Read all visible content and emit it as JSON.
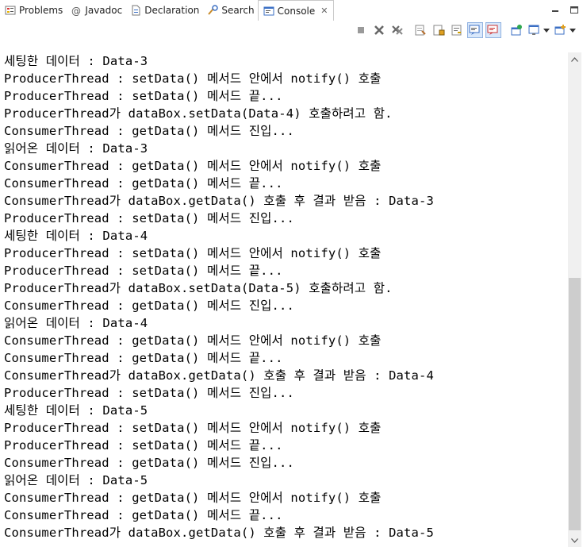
{
  "tabs": [
    {
      "label": "Problems",
      "icon": "problems-icon"
    },
    {
      "label": "Javadoc",
      "icon": "javadoc-icon"
    },
    {
      "label": "Declaration",
      "icon": "declaration-icon"
    },
    {
      "label": "Search",
      "icon": "search-icon"
    },
    {
      "label": "Console",
      "icon": "console-icon",
      "active": true
    }
  ],
  "console": {
    "lines": [
      "세팅한 데이터 : Data-3",
      "ProducerThread : setData() 메서드 안에서 notify() 호출",
      "ProducerThread : setData() 메서드 끝...",
      "ProducerThread가 dataBox.setData(Data-4) 호출하려고 함.",
      "ConsumerThread : getData() 메서드 진입...",
      "읽어온 데이터 : Data-3",
      "ConsumerThread : getData() 메서드 안에서 notify() 호출",
      "ConsumerThread : getData() 메서드 끝...",
      "ConsumerThread가 dataBox.getData() 호출 후 결과 받음 : Data-3",
      "ProducerThread : setData() 메서드 진입...",
      "세팅한 데이터 : Data-4",
      "ProducerThread : setData() 메서드 안에서 notify() 호출",
      "ProducerThread : setData() 메서드 끝...",
      "ProducerThread가 dataBox.setData(Data-5) 호출하려고 함.",
      "ConsumerThread : getData() 메서드 진입...",
      "읽어온 데이터 : Data-4",
      "ConsumerThread : getData() 메서드 안에서 notify() 호출",
      "ConsumerThread : getData() 메서드 끝...",
      "ConsumerThread가 dataBox.getData() 호출 후 결과 받음 : Data-4",
      "ProducerThread : setData() 메서드 진입...",
      "세팅한 데이터 : Data-5",
      "ProducerThread : setData() 메서드 안에서 notify() 호출",
      "ProducerThread : setData() 메서드 끝...",
      "ConsumerThread : getData() 메서드 진입...",
      "읽어온 데이터 : Data-5",
      "ConsumerThread : getData() 메서드 안에서 notify() 호출",
      "ConsumerThread : getData() 메서드 끝...",
      "ConsumerThread가 dataBox.getData() 호출 후 결과 받음 : Data-5"
    ]
  },
  "toolbar": {
    "buttons": [
      "terminate-icon",
      "remove-launch-icon",
      "remove-all-terminated-icon",
      "clear-console-icon",
      "scroll-lock-icon",
      "word-wrap-icon",
      "show-on-stdout-icon",
      "show-on-stderr-icon",
      "pin-console-icon",
      "display-console-icon",
      "open-console-icon"
    ]
  },
  "colors": {
    "accent": "#3b6fc4",
    "scrollbar_track": "#f0f0f0",
    "scrollbar_thumb": "#cdcdcd"
  }
}
